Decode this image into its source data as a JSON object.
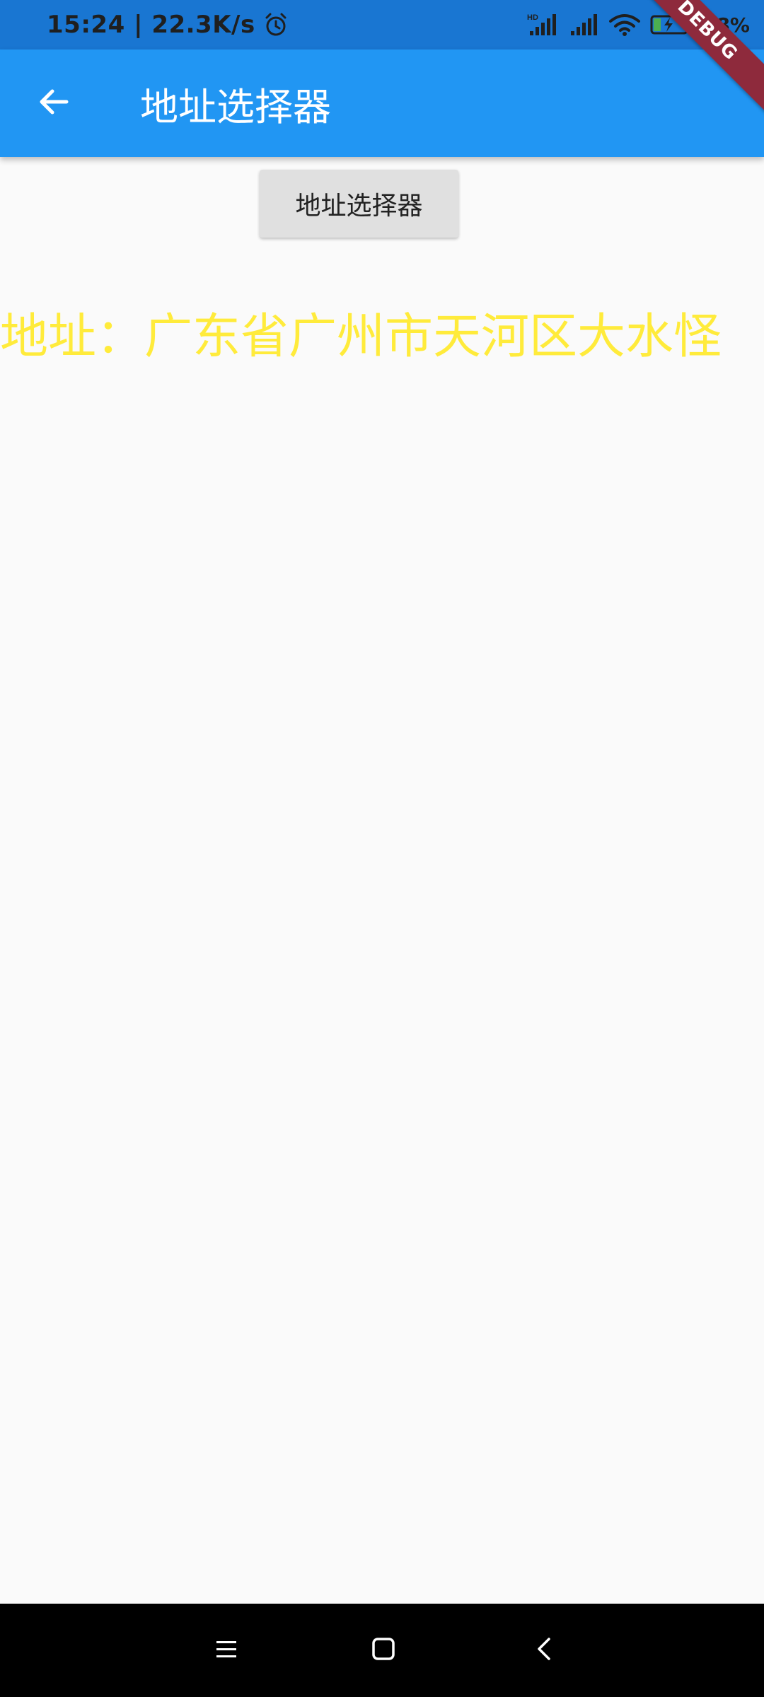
{
  "status_bar": {
    "time_speed": "15:24 | 22.3K/s",
    "battery_percent": "18%",
    "icons": [
      "alarm-icon",
      "hd-signal-icon",
      "signal-icon",
      "wifi-icon",
      "battery-charging-icon"
    ]
  },
  "app_bar": {
    "title": "地址选择器",
    "back_icon": "arrow-back-icon"
  },
  "debug_banner": "DEBUG",
  "main": {
    "button_label": "地址选择器",
    "address_text": "地址：广东省广州市天河区大水怪"
  },
  "nav_bar": {
    "icons": [
      "menu-icon",
      "home-icon",
      "back-icon"
    ]
  },
  "colors": {
    "status_bar": "#1976d2",
    "app_bar": "#2196f3",
    "address_text": "#ffeb3b",
    "background": "#fafafa",
    "button": "#e0e0e0",
    "debug_banner": "#8e2a3c"
  }
}
